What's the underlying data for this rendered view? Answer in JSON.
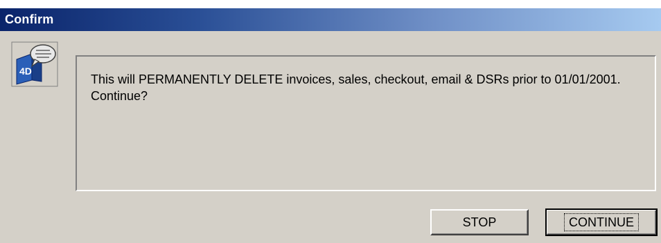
{
  "window": {
    "title": "Confirm"
  },
  "icon": {
    "name": "4d-app-icon",
    "label": "4D"
  },
  "message": {
    "text": "This will PERMANENTLY DELETE  invoices, sales, checkout, email & DSRs prior to 01/01/2001. Continue?"
  },
  "buttons": {
    "stop_label": "STOP",
    "continue_label": "CONTINUE"
  },
  "colors": {
    "title_gradient_start": "#0a246a",
    "title_gradient_end": "#a6caf0",
    "face": "#d4d0c8"
  }
}
